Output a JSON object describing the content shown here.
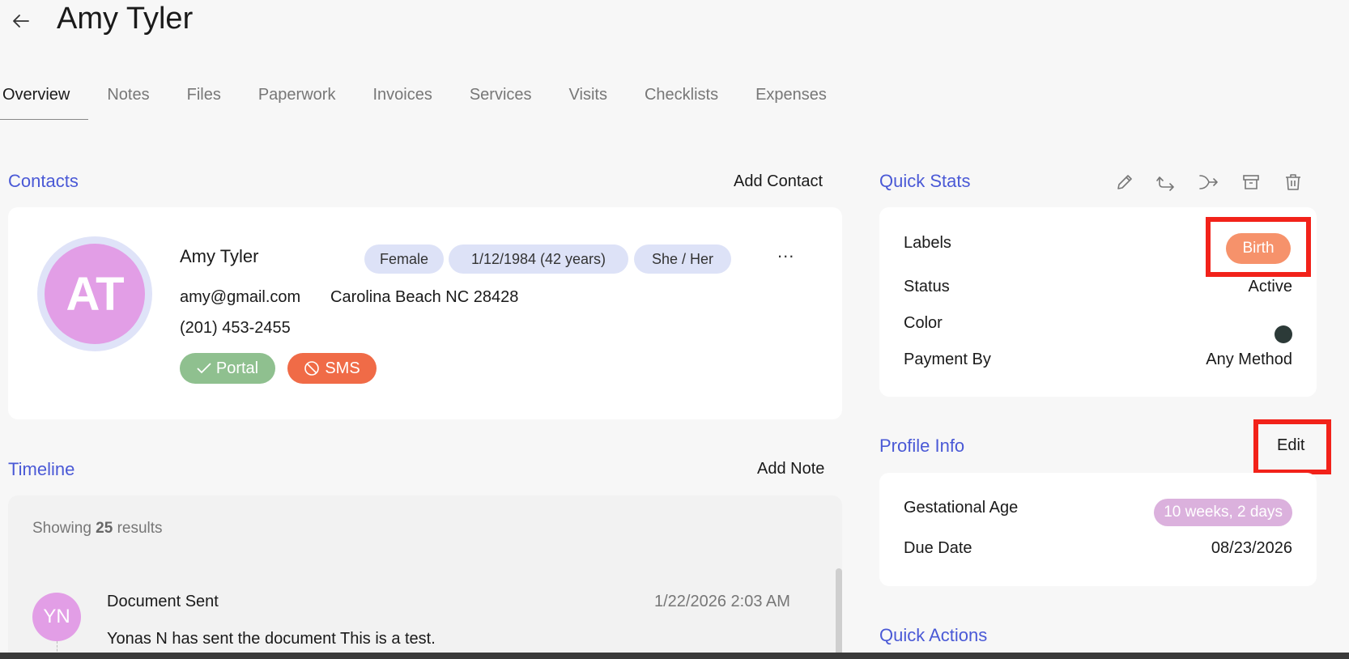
{
  "header": {
    "title": "Amy Tyler"
  },
  "tabs": [
    "Overview",
    "Notes",
    "Files",
    "Paperwork",
    "Invoices",
    "Services",
    "Visits",
    "Checklists",
    "Expenses"
  ],
  "contacts": {
    "title": "Contacts",
    "action": "Add Contact",
    "initials": "AT",
    "name": "Amy Tyler",
    "chips": [
      "Female",
      "1/12/1984 (42 years)",
      "She / Her"
    ],
    "more": "...",
    "email": "amy@gmail.com",
    "location": "Carolina Beach NC 28428",
    "phone": "(201) 453-2455",
    "portal_label": "Portal",
    "sms_label": "SMS",
    "colors": {
      "avatar": "#e29ee6",
      "portal": "#8fc08f",
      "sms": "#f06b47"
    }
  },
  "timeline": {
    "title": "Timeline",
    "action": "Add Note",
    "results_prefix": "Showing",
    "results_count": "25",
    "results_suffix": "results",
    "entry": {
      "initials": "YN",
      "title": "Document Sent",
      "date": "1/22/2026 2:03 AM",
      "description": "Yonas N has sent the document This is a test."
    }
  },
  "quick_stats": {
    "title": "Quick Stats",
    "icons": [
      "pencil-icon",
      "share-icon",
      "merge-icon",
      "archive-icon",
      "trash-icon"
    ],
    "labels_label": "Labels",
    "labels_badge": "Birth",
    "status_label": "Status",
    "status_value": "Active",
    "color_label": "Color",
    "color_value": "#2c3a38",
    "payment_label": "Payment By",
    "payment_value": "Any Method"
  },
  "profile_info": {
    "title": "Profile Info",
    "action": "Edit",
    "ga_label": "Gestational Age",
    "ga_value": "10 weeks, 2 days",
    "due_label": "Due Date",
    "due_value": "08/23/2026"
  },
  "quick_actions": {
    "title": "Quick Actions"
  },
  "theme": {
    "accent": "#4a59d6",
    "highlight": "#f2221a"
  }
}
